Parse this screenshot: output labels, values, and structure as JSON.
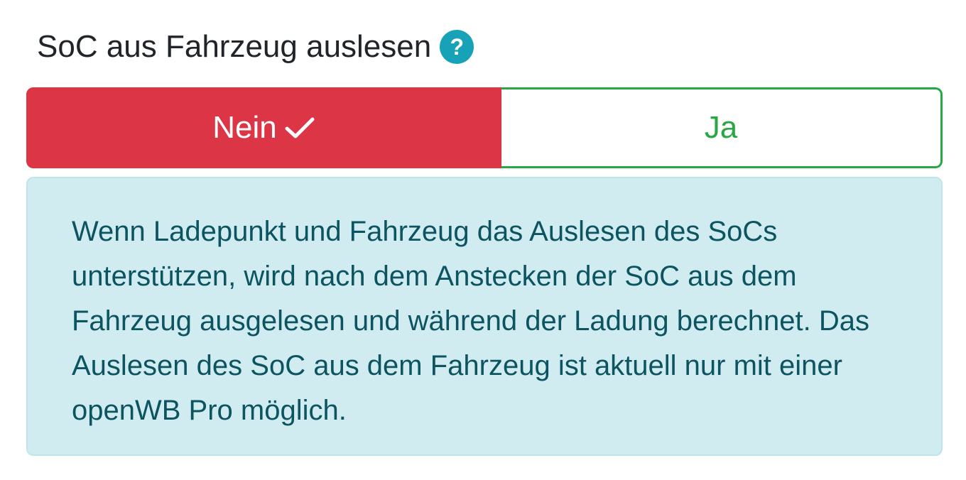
{
  "setting": {
    "title": "SoC aus Fahrzeug auslesen",
    "help_icon": "question-circle-icon",
    "help_glyph": "?"
  },
  "toggle": {
    "options": [
      {
        "label": "Nein",
        "selected": true,
        "color": "#dc3545"
      },
      {
        "label": "Ja",
        "selected": false,
        "color": "#28a745"
      }
    ],
    "selected_icon": "check-icon"
  },
  "info": {
    "text": "Wenn Ladepunkt und Fahrzeug das Auslesen des SoCs unterstützen, wird nach dem Anstecken der SoC aus dem Fahrzeug ausgelesen und während der Ladung berechnet. Das Auslesen des SoC aus dem Fahrzeug ist aktuell nur mit einer openWB Pro möglich.",
    "background": "#d1ecf1",
    "text_color": "#0c5460"
  }
}
